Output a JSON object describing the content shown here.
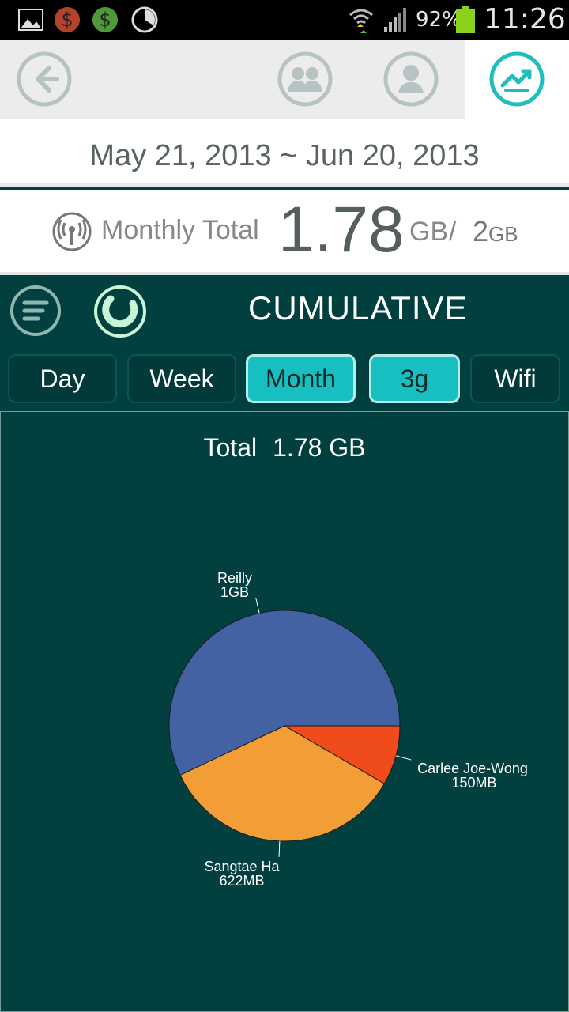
{
  "status_bar": {
    "battery_percent": "92%",
    "time": "11:26",
    "icons": [
      "image-icon",
      "dollar-red-icon",
      "dollar-green-icon",
      "clock-icon",
      "wifi-icon",
      "signal-icon",
      "battery-icon"
    ]
  },
  "toolbar": {
    "back_icon": "back-arrow-icon",
    "group_icon": "group-users-icon",
    "user_icon": "user-icon",
    "stats_icon": "trend-chart-icon",
    "accent": "#1fbcc0"
  },
  "date_range": "May 21, 2013 ~ Jun 20, 2013",
  "monthly_total": {
    "label": "Monthly Total",
    "value": "1.78",
    "unit": "GB",
    "separator": "/",
    "limit_value": "2",
    "limit_unit": "GB"
  },
  "panel": {
    "title": "CUMULATIVE",
    "tabs": [
      {
        "label": "Day",
        "active": false
      },
      {
        "label": "Week",
        "active": false
      },
      {
        "label": "Month",
        "active": true
      },
      {
        "label": "3g",
        "active": true
      },
      {
        "label": "Wifi",
        "active": false
      }
    ]
  },
  "chart_data": {
    "type": "pie",
    "title_label": "Total",
    "title_value": "1.78 GB",
    "slices": [
      {
        "name": "Reilly",
        "display": "1GB",
        "value": 1024,
        "color": "#4262a3"
      },
      {
        "name": "Carlee Joe-Wong",
        "display": "150MB",
        "value": 150,
        "color": "#f04b1b"
      },
      {
        "name": "Sangtae Ha",
        "display": "622MB",
        "value": 622,
        "color": "#f29d35"
      }
    ]
  }
}
